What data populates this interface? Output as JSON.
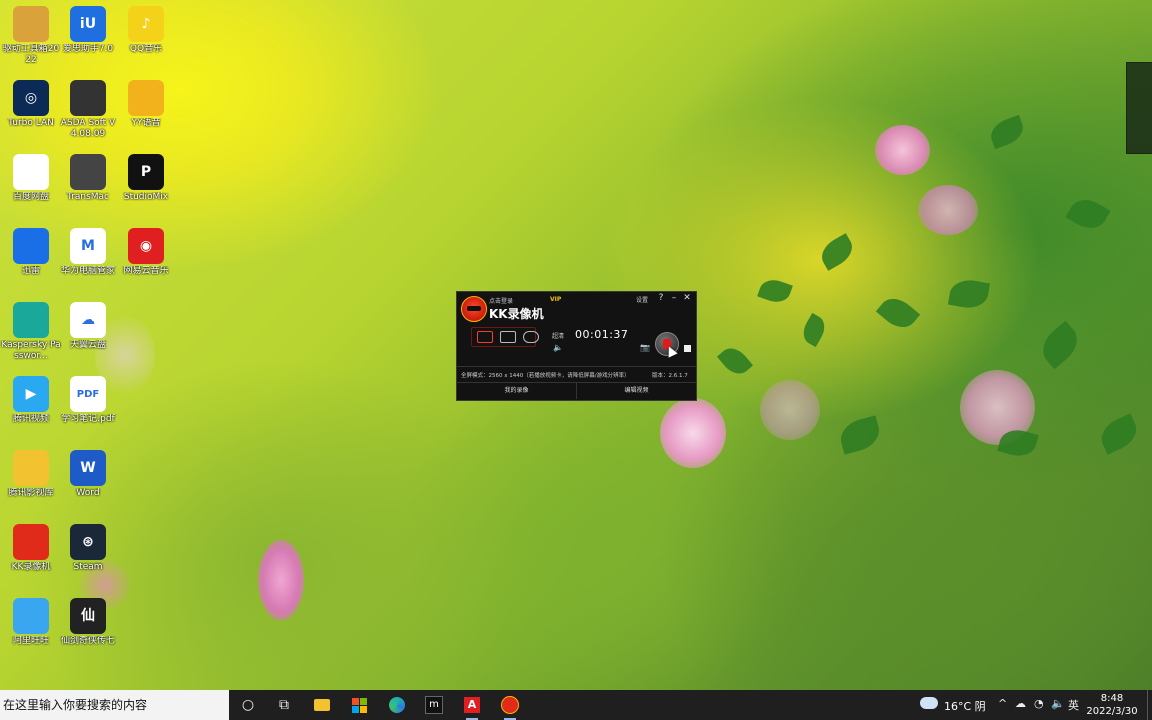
{
  "desktop_icons": [
    {
      "label": "驱动工具箱2022",
      "icon": "toolbox-icon",
      "color": "#d9a23a"
    },
    {
      "label": "爱思助手7.0",
      "icon": "i4-icon",
      "color": "#1f6fe0",
      "glyph": "iU"
    },
    {
      "label": "QQ音乐",
      "icon": "qq-music-icon",
      "color": "#f5d21a",
      "glyph": "♪"
    },
    {
      "label": "Turbo LAN",
      "icon": "turbo-lan-icon",
      "color": "#0b2a55",
      "glyph": "◎"
    },
    {
      "label": "ASDA Soft V4.08.09",
      "icon": "asda-soft-icon",
      "color": "#333333"
    },
    {
      "label": "YY语音",
      "icon": "yy-voice-icon",
      "color": "#f2b21c"
    },
    {
      "label": "百度网盘",
      "icon": "baidu-netdisk-icon",
      "color": "#ffffff"
    },
    {
      "label": "TransMac",
      "icon": "transmac-icon",
      "color": "#444444"
    },
    {
      "label": "StudioMix",
      "icon": "studiomix-icon",
      "color": "#111111",
      "glyph": "P"
    },
    {
      "label": "迅雷",
      "icon": "xunlei-icon",
      "color": "#1a6fe6"
    },
    {
      "label": "华为电脑管家",
      "icon": "huawei-pc-manager-icon",
      "color": "#ffffff",
      "glyph": "M"
    },
    {
      "label": "网易云音乐",
      "icon": "netease-music-icon",
      "color": "#e02020",
      "glyph": "◉"
    },
    {
      "label": "Kaspersky Passwor...",
      "icon": "kaspersky-password-icon",
      "color": "#1aa89a"
    },
    {
      "label": "天翼云盘",
      "icon": "tianyi-cloud-icon",
      "color": "#ffffff",
      "glyph": "☁"
    },
    {
      "label": "腾讯视频",
      "icon": "tencent-video-icon",
      "color": "#2aa8f0",
      "glyph": "▶"
    },
    {
      "label": "学习笔记.pdf",
      "icon": "pdf-file-icon",
      "color": "#ffffff",
      "glyph": "PDF"
    },
    {
      "label": "腾讯影视库",
      "icon": "tencent-media-folder-icon",
      "color": "#f2c230"
    },
    {
      "label": "Word",
      "icon": "word-icon",
      "color": "#1e5bc6",
      "glyph": "W"
    },
    {
      "label": "KK录像机",
      "icon": "kk-recorder-icon",
      "color": "#e02a1a"
    },
    {
      "label": "Steam",
      "icon": "steam-icon",
      "color": "#1b2838",
      "glyph": "⊛"
    },
    {
      "label": "阿里旺旺",
      "icon": "aliwangwang-icon",
      "color": "#3aa6f0"
    },
    {
      "label": "仙剑奇侠传七",
      "icon": "xianjian-7-icon",
      "color": "#222222",
      "glyph": "仙"
    }
  ],
  "kk_window": {
    "login_label": "点击登录",
    "vip_label": "VIP",
    "title": "KK录像机",
    "settings_label": "设置",
    "help_label": "?",
    "minimize_label": "–",
    "close_label": "✕",
    "quality_label": "超清",
    "timer": "00:01:37",
    "info_mode": "全屏模式：2560 x 1440（若播放视频卡，请降低屏幕/游戏分辨率）",
    "info_version": "版本：2.6.1.7",
    "tab_my_recordings": "我的录像",
    "tab_edit_video": "编辑视频"
  },
  "taskbar": {
    "search_placeholder": "在这里输入你要搜索的内容",
    "apps": [
      "cortana-icon",
      "task-view-icon",
      "file-explorer-icon",
      "microsoft-store-icon",
      "edge-icon",
      "meitu-icon",
      "adobe-acrobat-icon",
      "kk-recorder-icon"
    ],
    "weather": "16°C 阴",
    "ime": "英",
    "time": "8:48",
    "date": "2022/3/30"
  },
  "colors": {
    "kk_bg": "#121212",
    "kk_accent": "#ff3a2a",
    "vip": "#f5c000",
    "taskbar_bg": "#1f1f1f"
  }
}
